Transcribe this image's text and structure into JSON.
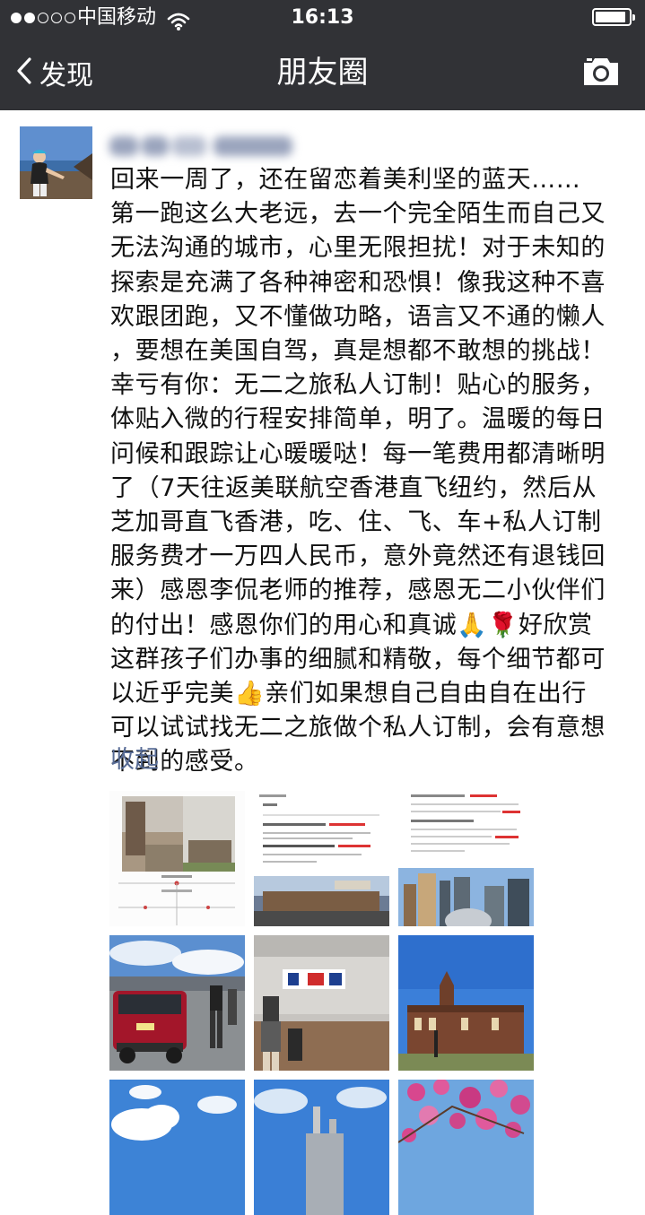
{
  "status_bar": {
    "carrier": "中国移动",
    "time": "16:13",
    "signal_bars": 2,
    "battery_level": 0.92,
    "icons": [
      "signal-dots-icon",
      "wifi-icon",
      "battery-icon"
    ]
  },
  "nav": {
    "back_label": "发现",
    "title": "朋友圈",
    "icons": [
      "chevron-left-icon",
      "camera-icon"
    ]
  },
  "post": {
    "text": "回来一周了，还在留恋着美利坚的蓝天……\n第一跑这么大老远，去一个完全陌生而自己又\n无法沟通的城市，心里无限担扰！对于未知的\n探索是充满了各种神密和恐惧！像我这种不喜\n欢跟团跑，又不懂做功略，语言又不通的懒人\n，要想在美国自驾，真是想都不敢想的挑战！\n幸亏有你：无二之旅私人订制！贴心的服务，\n体贴入微的行程安排简单，明了。温暖的每日\n问候和跟踪让心暖暖哒！每一笔费用都清晰明\n了（7天往返美联航空香港直飞纽约，然后从\n芝加哥直飞香港，吃、住、飞、车+私人订制\n服务费才一万四人民币，意外竟然还有退钱回\n来）感恩李侃老师的推荐，感恩无二小伙伴们\n的付出！感恩你们的用心和真诚🙏🌹好欣赏\n这群孩子们办事的细腻和精敬，每个细节都可\n以近乎完美👍亲们如果想自己自由自在出行\n可以试试找无二之旅做个私人订制，会有意想\n不到的感受。",
    "collapse_label": "收起",
    "photos": [
      "itinerary-page-photo",
      "itinerary-document-photo",
      "itinerary-document-photo",
      "red-suv-parking-photo",
      "airport-counter-photo",
      "brick-building-blue-sky-photo",
      "clouds-sky-photo",
      "tower-sky-photo",
      "pink-blossoms-photo"
    ]
  }
}
